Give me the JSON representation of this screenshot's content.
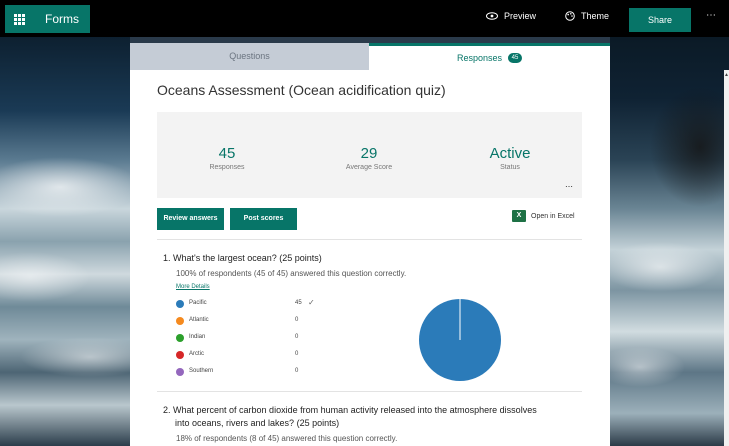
{
  "app": {
    "name": "Forms"
  },
  "topbar": {
    "preview_label": "Preview",
    "theme_label": "Theme",
    "share_label": "Share",
    "more_label": "⋯"
  },
  "tabs": {
    "questions_label": "Questions",
    "responses_label": "Responses",
    "responses_count": "45"
  },
  "form": {
    "title": "Oceans Assessment (Ocean acidification quiz)"
  },
  "summary": {
    "responses_value": "45",
    "responses_label": "Responses",
    "avg_value": "29",
    "avg_label": "Average Score",
    "status_value": "Active",
    "status_label": "Status",
    "more_label": "⋯"
  },
  "actions": {
    "review_label": "Review answers",
    "post_label": "Post scores",
    "excel_label": "Open in Excel",
    "excel_icon_letter": "X"
  },
  "questions": [
    {
      "title": "1.  What's the largest ocean? (25 points)",
      "summary": "100% of respondents (45 of 45) answered this question correctly.",
      "more_details": "More Details",
      "options": [
        {
          "label": "Pacific",
          "count": "45",
          "color": "#2b7bb9",
          "correct": true
        },
        {
          "label": "Atlantic",
          "count": "0",
          "color": "#f58a1f",
          "correct": false
        },
        {
          "label": "Indian",
          "count": "0",
          "color": "#2ca02c",
          "correct": false
        },
        {
          "label": "Arctic",
          "count": "0",
          "color": "#d62728",
          "correct": false
        },
        {
          "label": "Southern",
          "count": "0",
          "color": "#9467bd",
          "correct": false
        }
      ],
      "check_mark": "✓"
    },
    {
      "title_line1": "2.  What percent of carbon dioxide from human activity released into the atmosphere dissolves",
      "title_line2": "into oceans, rivers and lakes? (25 points)",
      "summary": "18% of respondents (8 of 45) answered this question correctly."
    }
  ],
  "colors": {
    "accent": "#077568",
    "pie_fill": "#2b7bb9"
  }
}
